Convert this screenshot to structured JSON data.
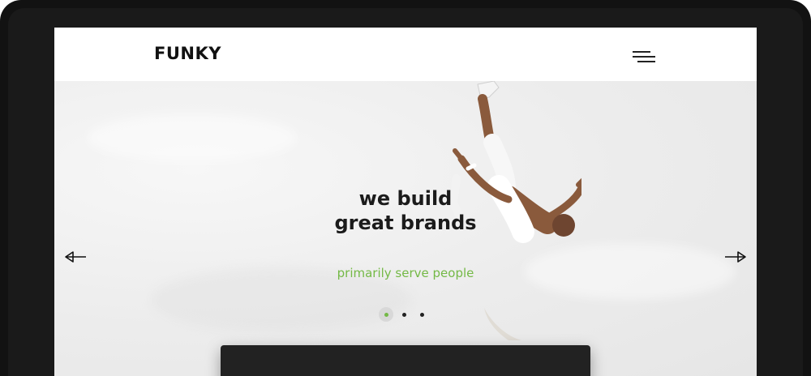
{
  "brand": {
    "logo_text": "FUNKY"
  },
  "header": {
    "menu_icon": "hamburger-menu-icon"
  },
  "hero": {
    "headline_line1": "we build",
    "headline_line2": "great brands",
    "subline": "primarily serve people",
    "prev_icon": "arrow-left-icon",
    "next_icon": "arrow-right-icon"
  },
  "slider": {
    "slides": 3,
    "active_index": 0
  },
  "colors": {
    "accent": "#74b946",
    "text_dark": "#1b1b1b",
    "device_frame": "#121212",
    "panel": "#222222"
  }
}
